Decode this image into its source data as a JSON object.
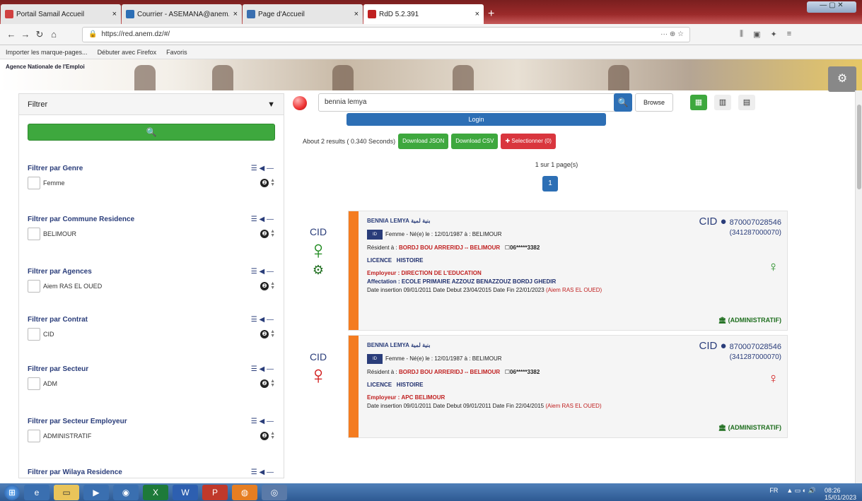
{
  "browser": {
    "tabs": [
      {
        "label": "Portail Samail Accueil",
        "color": "#d04040"
      },
      {
        "label": "Courrier - ASEMANA@anem.dz",
        "color": "#2d6fb5"
      },
      {
        "label": "Page d'Accueil",
        "color": "#3a6fb0"
      },
      {
        "label": "RdD 5.2.391",
        "color": "#c02020"
      }
    ],
    "url": "https://red.anem.dz/#/",
    "url_actions": "··· ⊕ ☆",
    "bookmarks": [
      "Importer les marque-pages...",
      "Débuter avec Firefox",
      "Favoris"
    ]
  },
  "banner": {
    "org": "Agence Nationale de l'Emploi"
  },
  "filters": {
    "title": "Filtrer",
    "groups": [
      {
        "title": "Filtrer par Genre",
        "value": "Femme"
      },
      {
        "title": "Filtrer par Commune Residence",
        "value": "BELIMOUR"
      },
      {
        "title": "Filtrer par Agences",
        "value": "Aiem RAS EL OUED"
      },
      {
        "title": "Filtrer par Contrat",
        "value": "CID"
      },
      {
        "title": "Filtrer par Secteur",
        "value": "ADM"
      },
      {
        "title": "Filtrer par Secteur Employeur",
        "value": "ADMINISTRATIF"
      },
      {
        "title": "Filtrer par Wilaya Residence",
        "value": ""
      }
    ],
    "tools": "☰ ◀ —"
  },
  "search": {
    "query": "bennia lemya",
    "browse_label": "Browse",
    "login_label": "Login"
  },
  "results": {
    "summary": "About 2 results ( 0.340 Seconds)",
    "download_json": "Download JSON",
    "download_csv": "Download CSV",
    "selection": "✚ Selectionner (0)",
    "page_info": "1 sur 1 page(s)",
    "current_page": "1"
  },
  "cards": [
    {
      "left_label": "CID",
      "name": "BENNIA LEMYA",
      "name_ar": "بنية لمية",
      "gender_line": "Femme - Né(e) le : 12/01/1987 à : BELIMOUR",
      "resident_prefix": "Résident à :",
      "resident": "BORDJ BOU ARRERIDJ -- BELIMOUR",
      "phone": "06*****3382",
      "diploma": "LICENCE",
      "field": "HISTOIRE",
      "employer_prefix": "Employeur :",
      "employer": "DIRECTION DE L'EDUCATION",
      "affectation": "Affectation : ECOLE PRIMAIRE AZZOUZ BENAZZOUZ BORDJ GHEDIR",
      "dates": "Date insertion 09/01/2011 Date Debut 23/04/2015 Date Fin 22/01/2023",
      "agency": "(Aiem RAS EL OUED)",
      "cid_label": "CID",
      "cid_code": "870007028546",
      "cid_sub": "(341287000070)",
      "admin": "(ADMINISTRATIF)",
      "fig_color": "#1e8a1e"
    },
    {
      "left_label": "CID",
      "name": "BENNIA LEMYA",
      "name_ar": "بنية لمية",
      "gender_line": "Femme - Né(e) le : 12/01/1987 à : BELIMOUR",
      "resident_prefix": "Résident à :",
      "resident": "BORDJ BOU ARRERIDJ -- BELIMOUR",
      "phone": "06*****3382",
      "diploma": "LICENCE",
      "field": "HISTOIRE",
      "employer_prefix": "Employeur :",
      "employer": "APC BELIMOUR",
      "affectation": "",
      "dates": "Date insertion 09/01/2011 Date Debut 09/01/2011 Date Fin 22/04/2015",
      "agency": "(Aiem RAS EL OUED)",
      "cid_label": "CID",
      "cid_code": "870007028546",
      "cid_sub": "(341287000070)",
      "admin": "(ADMINISTRATIF)",
      "fig_color": "#d11a1a"
    }
  ],
  "taskbar": {
    "tray_lang": "FR",
    "time": "08:26",
    "date": "15/01/2023"
  }
}
